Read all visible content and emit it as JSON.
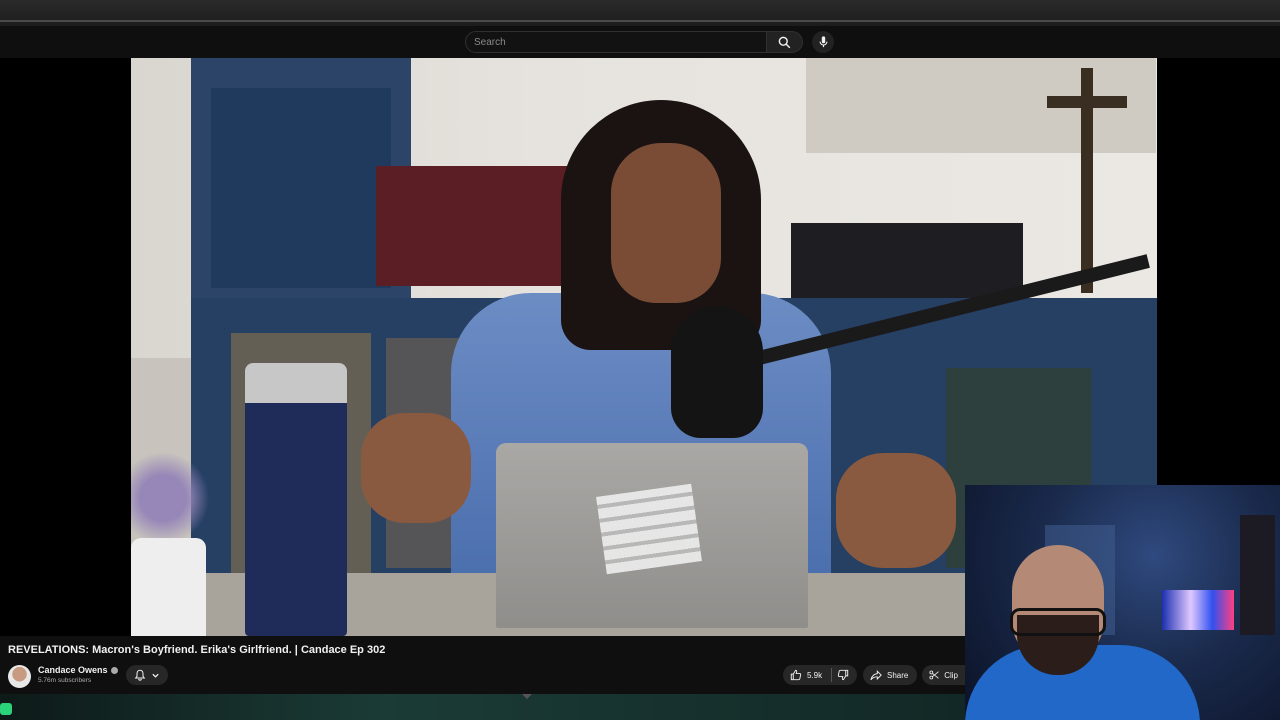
{
  "search": {
    "placeholder": "Search"
  },
  "video": {
    "title": "REVELATIONS: Macron's Boyfriend. Erika's Girlfriend. | Candace Ep 302"
  },
  "channel": {
    "name": "Candace Owens",
    "subscribers": "5.76m subscribers"
  },
  "actions": {
    "likes": "5.9k",
    "share_label": "Share",
    "clip_label": "Clip"
  },
  "icons": {
    "search": "search-icon",
    "mic": "mic-icon",
    "bell": "bell-icon",
    "like": "thumbs-up-icon",
    "dislike": "thumbs-down-icon",
    "share": "share-icon",
    "clip": "scissors-icon"
  },
  "colors": {
    "background": "#0f0f0f",
    "pill": "#272727",
    "text": "#f1f1f1",
    "muted": "#aaaaaa"
  }
}
